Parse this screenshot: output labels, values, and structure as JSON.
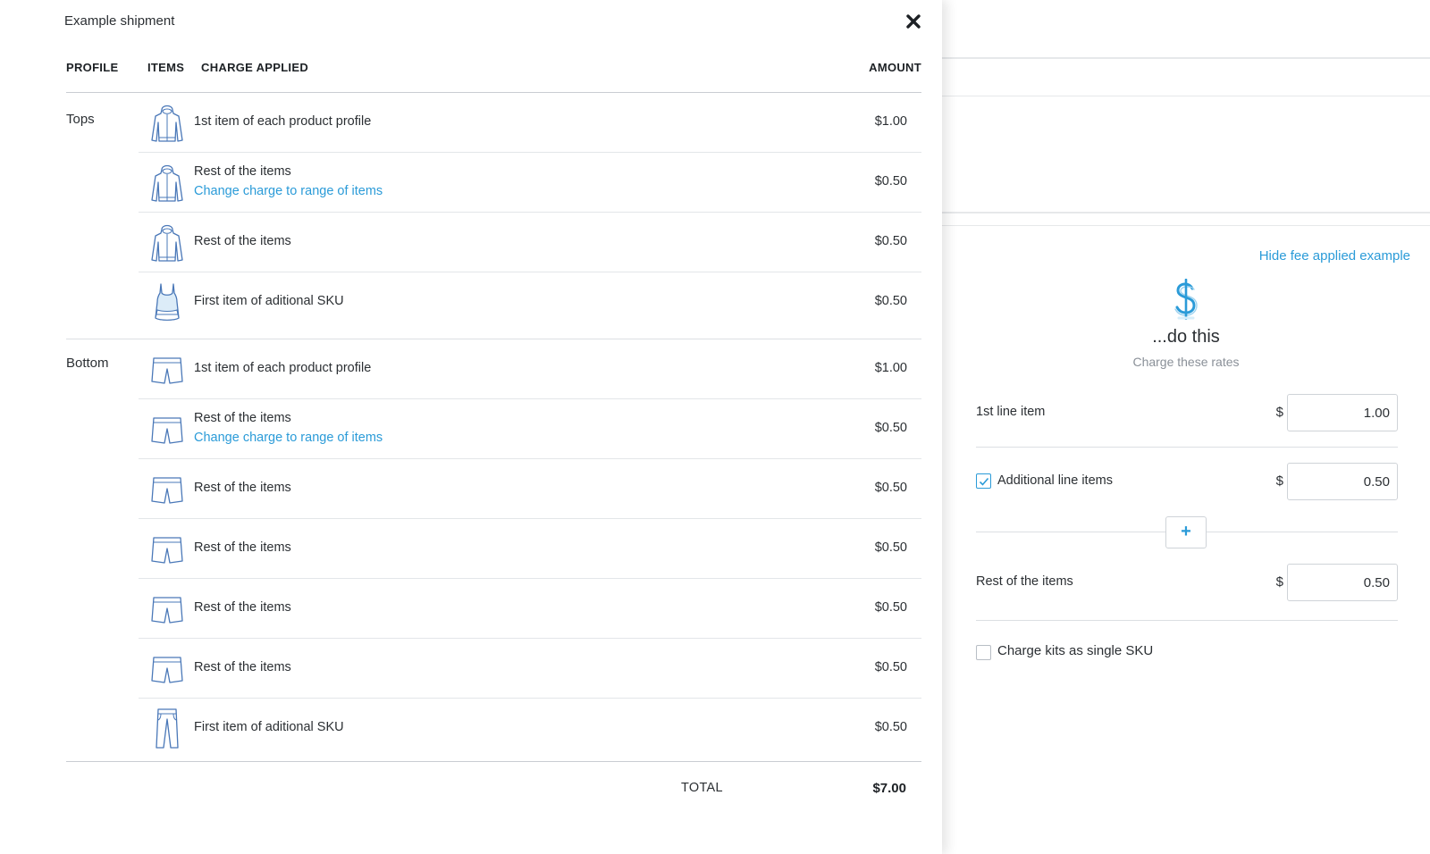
{
  "modal": {
    "title": "Example shipment",
    "columns": {
      "profile": "PROFILE",
      "items": "ITEMS",
      "charge": "CHARGE APPLIED",
      "amount": "AMOUNT"
    },
    "groups": [
      {
        "profile": "Tops",
        "rows": [
          {
            "icon": "hoodie-icon",
            "charge": "1st item of each product profile",
            "link": "",
            "amount": "$1.00"
          },
          {
            "icon": "hoodie-icon",
            "charge": "Rest of the items",
            "link": "Change charge to range of items",
            "amount": "$0.50"
          },
          {
            "icon": "hoodie-icon",
            "charge": "Rest of the items",
            "link": "",
            "amount": "$0.50"
          },
          {
            "icon": "tank-top-icon",
            "charge": "First item of aditional SKU",
            "link": "",
            "amount": "$0.50"
          }
        ]
      },
      {
        "profile": "Bottom",
        "rows": [
          {
            "icon": "shorts-icon",
            "charge": "1st item of each product profile",
            "link": "",
            "amount": "$1.00"
          },
          {
            "icon": "shorts-icon",
            "charge": "Rest of the items",
            "link": "Change charge to range of items",
            "amount": "$0.50"
          },
          {
            "icon": "shorts-icon",
            "charge": "Rest of the items",
            "link": "",
            "amount": "$0.50"
          },
          {
            "icon": "shorts-icon",
            "charge": "Rest of the items",
            "link": "",
            "amount": "$0.50"
          },
          {
            "icon": "shorts-icon",
            "charge": "Rest of the items",
            "link": "",
            "amount": "$0.50"
          },
          {
            "icon": "shorts-icon",
            "charge": "Rest of the items",
            "link": "",
            "amount": "$0.50"
          },
          {
            "icon": "pants-icon",
            "charge": "First item of aditional SKU",
            "link": "",
            "amount": "$0.50"
          }
        ]
      }
    ],
    "total": {
      "label": "TOTAL",
      "value": "$7.00"
    }
  },
  "panel": {
    "hide_link": "Hide fee applied example",
    "heading": "...do this",
    "subheading": "Charge these rates",
    "currency": "$",
    "first_line": {
      "label": "1st line item",
      "value": "1.00"
    },
    "additional": {
      "label": "Additional line items",
      "value": "0.50",
      "checked": true
    },
    "add_button": "+",
    "rest": {
      "label": "Rest of the items",
      "value": "0.50"
    },
    "kits": {
      "label": "Charge kits as single SKU",
      "checked": false
    },
    "accent_color": "#2b9bd8"
  }
}
